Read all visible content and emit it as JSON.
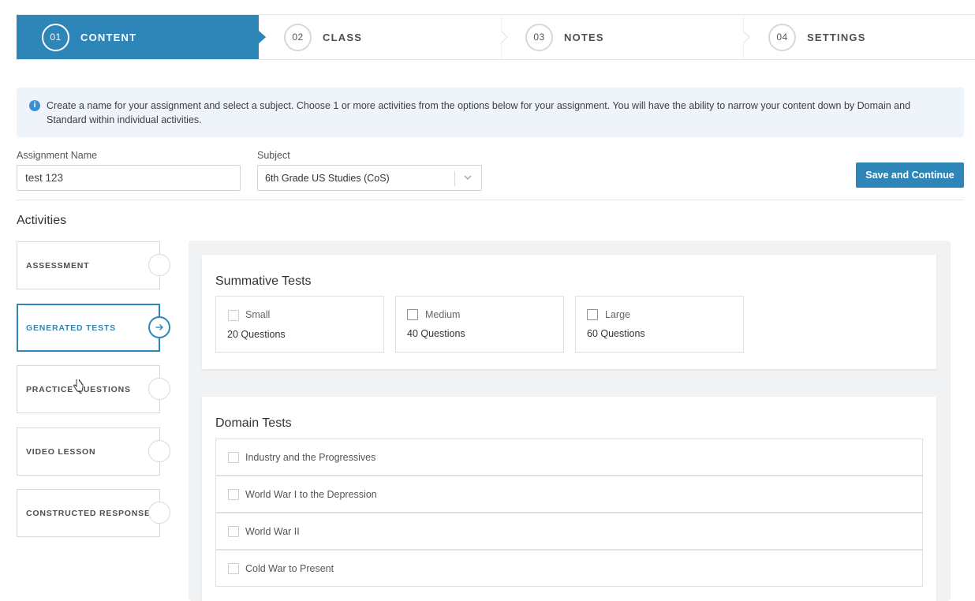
{
  "stepper": [
    {
      "num": "01",
      "label": "CONTENT",
      "active": true
    },
    {
      "num": "02",
      "label": "CLASS",
      "active": false
    },
    {
      "num": "03",
      "label": "NOTES",
      "active": false
    },
    {
      "num": "04",
      "label": "SETTINGS",
      "active": false
    }
  ],
  "info": {
    "icon": "info-icon",
    "text": "Create a name for your assignment and select a subject. Choose 1 or more activities from the options below for your assignment. You will have the ability to narrow your content down by Domain and Standard within individual activities."
  },
  "form": {
    "assignment_label": "Assignment Name",
    "assignment_value": "test 123",
    "subject_label": "Subject",
    "subject_value": "6th Grade US Studies (CoS)",
    "save_label": "Save and Continue"
  },
  "activities": {
    "title": "Activities",
    "items": [
      {
        "label": "ASSESSMENT",
        "selected": false
      },
      {
        "label": "GENERATED TESTS",
        "selected": true
      },
      {
        "label": "PRACTICE QUESTIONS",
        "selected": false
      },
      {
        "label": "VIDEO LESSON",
        "selected": false
      },
      {
        "label": "CONSTRUCTED RESPONSE",
        "selected": false
      }
    ]
  },
  "summative": {
    "title": "Summative Tests",
    "options": [
      {
        "name": "Small",
        "count": "20 Questions"
      },
      {
        "name": "Medium",
        "count": "40 Questions"
      },
      {
        "name": "Large",
        "count": "60 Questions"
      }
    ]
  },
  "domain": {
    "title": "Domain Tests",
    "items": [
      "Industry and the Progressives",
      "World War I to the Depression",
      "World War II",
      "Cold War to Present"
    ]
  },
  "colors": {
    "accent": "#2e86b8",
    "info_bg": "#eef4fa",
    "panel_bg": "#f1f2f4"
  }
}
